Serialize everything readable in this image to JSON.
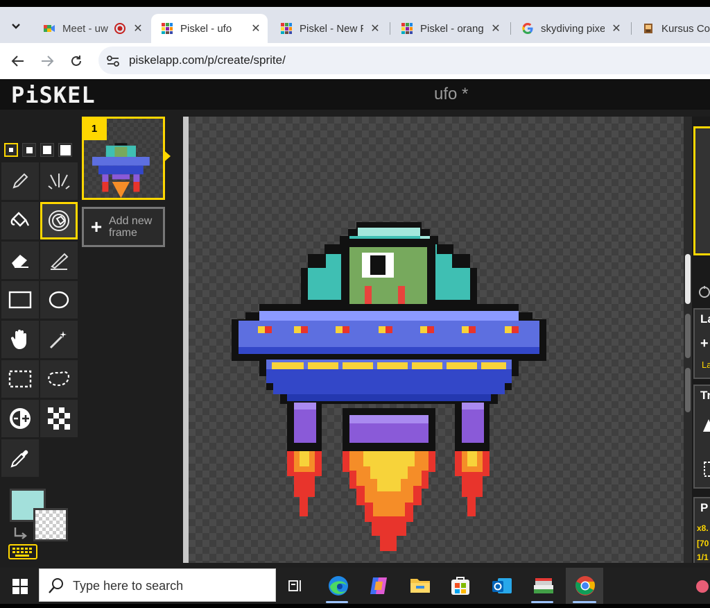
{
  "browser": {
    "tabs": [
      {
        "title": "Meet - uw",
        "favicon": "google-meet-icon",
        "recording": true
      },
      {
        "title": "Piskel - ufo",
        "favicon": "piskel-icon",
        "active": true
      },
      {
        "title": "Piskel - New P",
        "favicon": "piskel-icon"
      },
      {
        "title": "Piskel - orang",
        "favicon": "piskel-icon"
      },
      {
        "title": "skydiving pixe",
        "favicon": "google-icon"
      },
      {
        "title": "Kursus Codi",
        "favicon": "kursus-icon"
      }
    ],
    "close_glyph": "✕",
    "url": "piskelapp.com/p/create/sprite/"
  },
  "piskel": {
    "logo": "PiSKEL",
    "sprite_name": "ufo *",
    "tools": [
      "pen-icon",
      "vertical-mirror-pen-icon",
      "paint-bucket-icon",
      "paint-all-similar-icon",
      "eraser-icon",
      "stroke-icon",
      "rectangle-icon",
      "circle-icon",
      "hand-icon",
      "magic-wand-icon",
      "rectangle-selection-icon",
      "lasso-selection-icon",
      "lighten-icon",
      "dithering-icon",
      "color-picker-icon"
    ],
    "active_tool": "paint-all-similar-icon",
    "pen_size_selected": 1,
    "frames": [
      {
        "number": "1"
      }
    ],
    "add_frame_label": "Add new frame",
    "primary_color": "#a3e0db",
    "secondary_color": "transparent",
    "right_panel": {
      "layers_title": "La",
      "layer_name": "La",
      "transform_title": "Tr",
      "palettes_title": "P",
      "zoom": "x8.",
      "cursor": "[70",
      "frame_counter": "1/1"
    }
  },
  "taskbar": {
    "search_placeholder": "Type here to search",
    "apps": [
      "task-view-icon",
      "edge-icon",
      "copilot-icon",
      "file-explorer-icon",
      "store-icon",
      "outlook-icon",
      "printer-app-icon",
      "chrome-icon"
    ]
  },
  "colors": {
    "accent": "#ffd700",
    "dome": "#3fbfb3",
    "alien": "#77a95d",
    "saucer_top": "#5d6fe0",
    "saucer_bottom": "#3347c8",
    "legs": "#8a5ad8",
    "flame_red": "#e8342c",
    "flame_orange": "#f58d28",
    "flame_yellow": "#f7d33a"
  }
}
